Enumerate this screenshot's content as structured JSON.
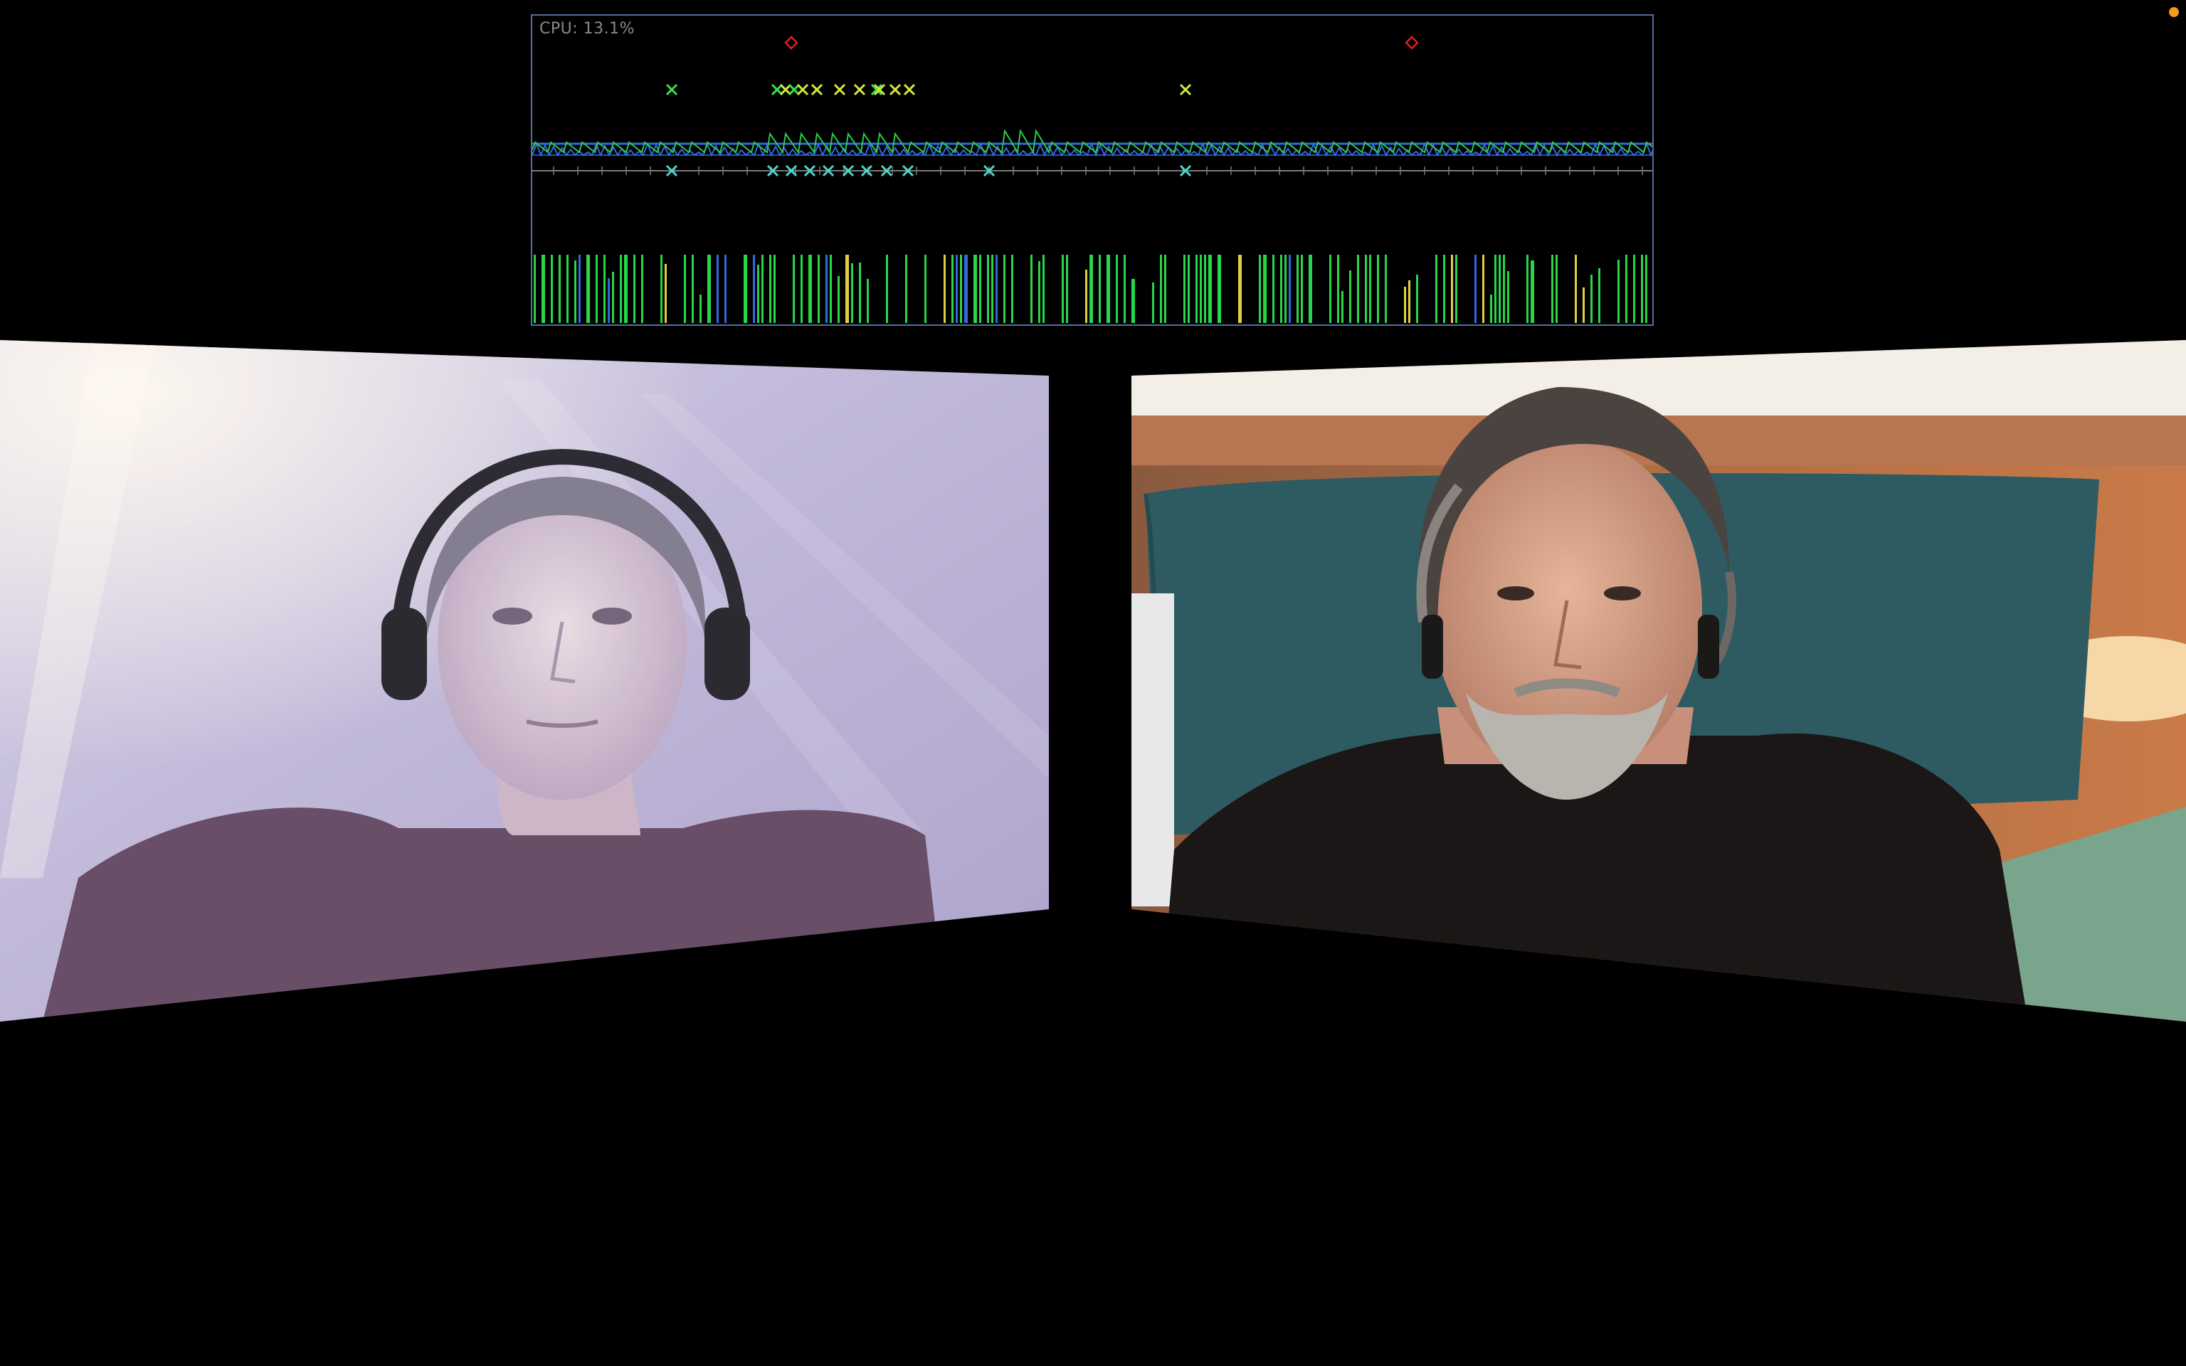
{
  "perf_overlay": {
    "cpu_label": "CPU: 13.1%",
    "colors": {
      "border": "#5a6e9c",
      "line_blue": "#2f6ae0",
      "line_green": "#2ec84a",
      "marker_green": "#3be04b",
      "marker_yellow": "#d8e63a",
      "marker_cyan": "#4fd6c8",
      "marker_red": "#e21e1e",
      "bar_green": "#28d64a",
      "bar_blue": "#2f6ae0",
      "bar_yellow": "#e0d040"
    }
  },
  "participants": [
    {
      "id": "left",
      "icon": "video-feed-icon"
    },
    {
      "id": "right",
      "icon": "video-feed-icon"
    }
  ],
  "status": {
    "icon": "status-dot-icon",
    "color": "#f29a1a"
  }
}
